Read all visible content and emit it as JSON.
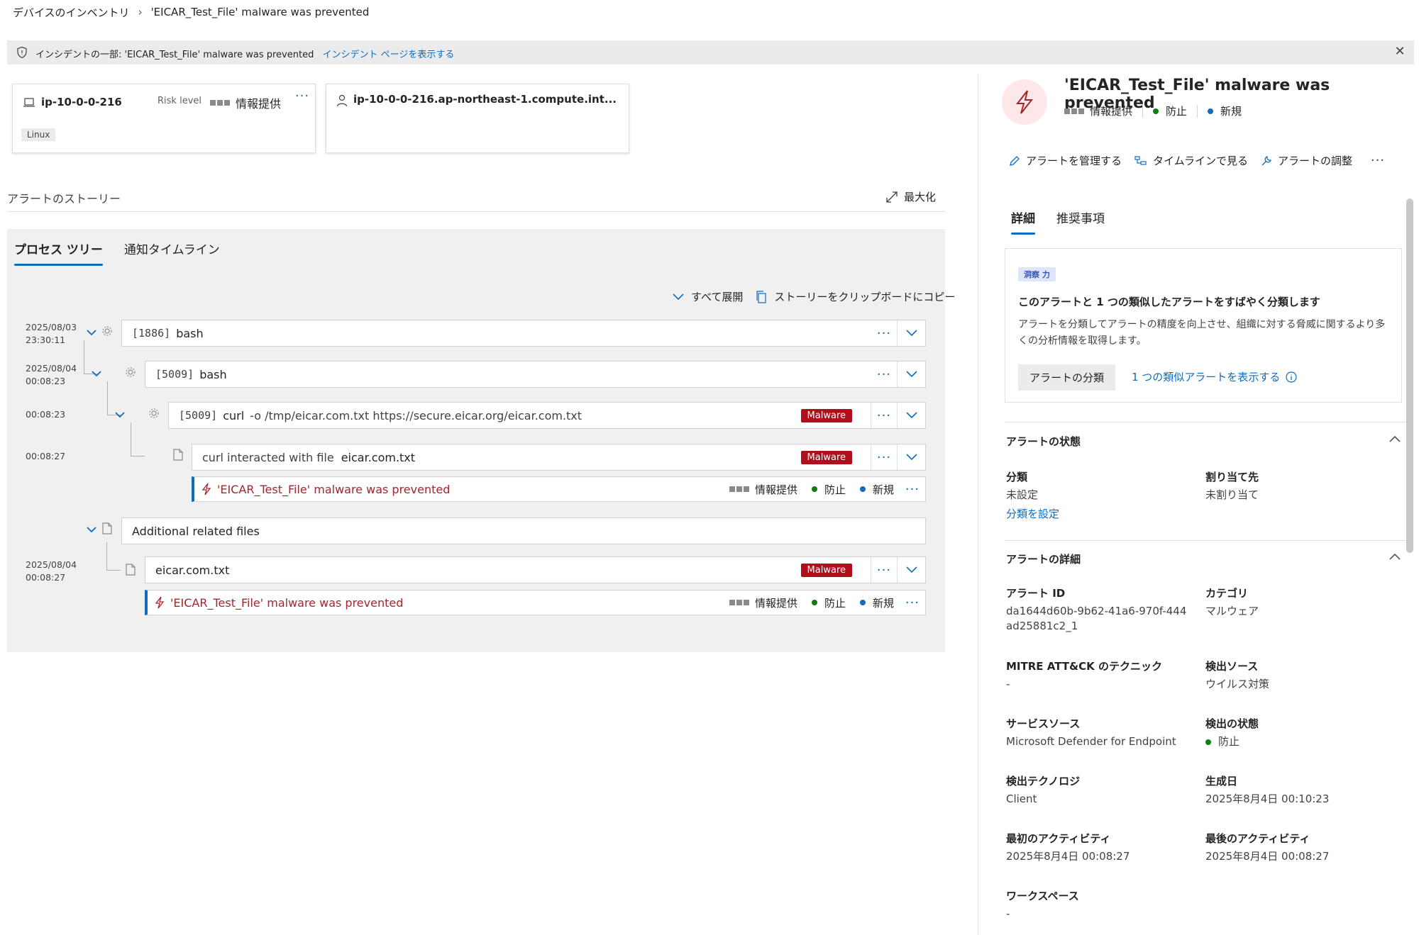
{
  "breadcrumb": {
    "parent": "デバイスのインベントリ",
    "current": "'EICAR_Test_File' malware was prevented"
  },
  "banner": {
    "prefix": "インシデントの一部: 'EICAR_Test_File' malware was prevented",
    "link": "インシデント ページを表示する"
  },
  "device": {
    "hostname": "ip-10-0-0-216",
    "risk_label": "Risk level",
    "risk_value": "情報提供",
    "os_tag": "Linux",
    "more": "···"
  },
  "host": {
    "fqdn": "ip-10-0-0-216.ap-northeast-1.compute.int..."
  },
  "story": {
    "title": "アラートのストーリー",
    "maximize": "最大化",
    "tabs": [
      "プロセス ツリー",
      "通知タイムライン"
    ],
    "expand_all": "すべて展開",
    "copy_story": "ストーリーをクリップボードにコピー",
    "timestamps": {
      "t1_date": "2025/08/03",
      "t1_time": "23:30:11",
      "t2_date": "2025/08/04",
      "t2_time": "00:08:23",
      "t3_time": "00:08:23",
      "t4_time": "00:08:27",
      "t5_date": "2025/08/04",
      "t5_time": "00:08:27"
    },
    "rows": {
      "bash1_pid": "[1886]",
      "bash1_name": "bash",
      "bash2_pid": "[5009]",
      "bash2_name": "bash",
      "curl_pid": "[5009]",
      "curl_name": "curl",
      "curl_cmd": "-o /tmp/eicar.com.txt https://secure.eicar.org/eicar.com.txt",
      "interact_prefix": "curl interacted with file",
      "interact_file": "eicar.com.txt",
      "related": "Additional related files",
      "eicar_file": "eicar.com.txt"
    },
    "malware_badge": "Malware",
    "alert": {
      "title": "'EICAR_Test_File' malware was prevented",
      "severity": "情報提供",
      "status": "防止",
      "state": "新規"
    },
    "more": "···"
  },
  "panel": {
    "title": "'EICAR_Test_File' malware was prevented",
    "severity": "情報提供",
    "status": "防止",
    "state": "新規",
    "actions": [
      "アラートを管理する",
      "タイムラインで見る",
      "アラートの調整"
    ],
    "more": "···",
    "tabs": [
      "詳細",
      "推奨事項"
    ],
    "insight": {
      "badge": "洞察 力",
      "heading": "このアラートと 1 つの類似したアラートをすばやく分類します",
      "body": "アラートを分類してアラートの精度を向上させ、組織に対する脅威に関するより多くの分析情報を取得します。",
      "button": "アラートの分類",
      "link": "1 つの類似アラートを表示する"
    },
    "status_section": {
      "title": "アラートの状態",
      "classification_label": "分類",
      "classification_value": "未設定",
      "classification_link": "分類を設定",
      "assigned_label": "割り当て先",
      "assigned_value": "未割り当て"
    },
    "details_section": {
      "title": "アラートの詳細",
      "alert_id_label": "アラート ID",
      "alert_id_value": "da1644d60b-9b62-41a6-970f-444ad25881c2_1",
      "category_label": "カテゴリ",
      "category_value": "マルウェア",
      "mitre_label": "MITRE ATT&CK のテクニック",
      "mitre_value": "-",
      "detection_source_label": "検出ソース",
      "detection_source_value": "ウイルス対策",
      "service_source_label": "サービスソース",
      "service_source_value": "Microsoft Defender for Endpoint",
      "detection_status_label": "検出の状態",
      "detection_status_value": "防止",
      "detection_tech_label": "検出テクノロジ",
      "detection_tech_value": "Client",
      "generated_label": "生成日",
      "generated_value": "2025年8月4日 00:10:23",
      "first_activity_label": "最初のアクティビティ",
      "first_activity_value": "2025年8月4日 00:08:27",
      "last_activity_label": "最後のアクティビティ",
      "last_activity_value": "2025年8月4日 00:08:27",
      "workspace_label": "ワークスペース",
      "workspace_value": "-"
    }
  },
  "colors": {
    "accent": "#0f6cbd",
    "malware": "#b10e1c",
    "alert_text": "#a4262c",
    "prevented": "#107c10"
  }
}
